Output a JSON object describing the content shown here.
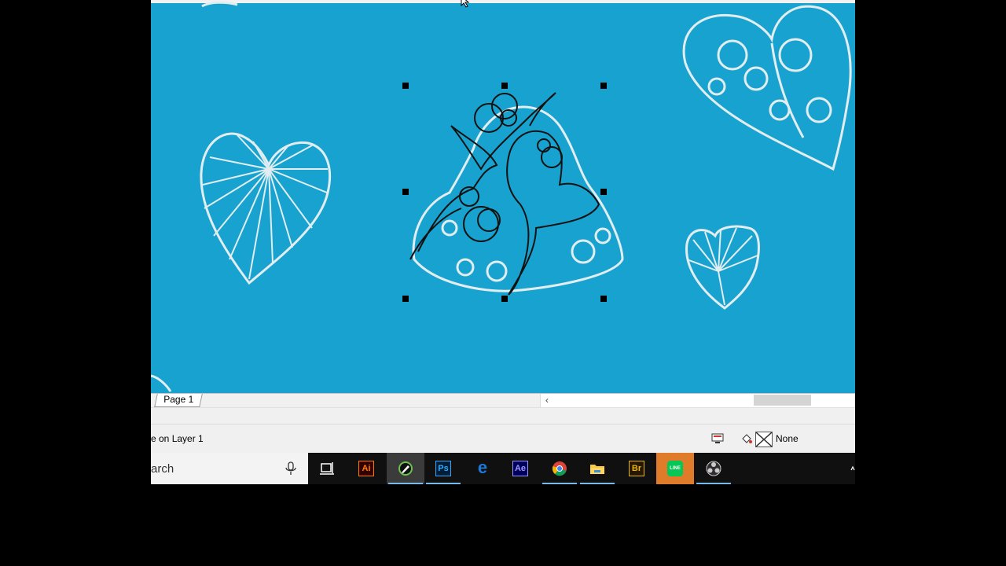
{
  "canvas": {
    "background_color": "#17a2cf",
    "pattern_color": "#dfe9ec",
    "selected_object": "filigree-heart-path"
  },
  "page_tabs": {
    "active_tab": "Page 1"
  },
  "status": {
    "text": "e on Layer 1",
    "fill_label": "None"
  },
  "taskbar": {
    "search_text": "arch",
    "apps": [
      {
        "icon": "task-view-icon"
      },
      {
        "icon": "illustrator-icon",
        "label": "Ai",
        "color": "#ff7c00"
      },
      {
        "icon": "coreldraw-icon"
      },
      {
        "icon": "photoshop-icon",
        "label": "Ps",
        "color": "#31a8ff"
      },
      {
        "icon": "edge-icon",
        "label": "e",
        "color": "#1e78d6"
      },
      {
        "icon": "after-effects-icon",
        "label": "Ae",
        "color": "#9999ff"
      },
      {
        "icon": "chrome-icon"
      },
      {
        "icon": "file-explorer-icon"
      },
      {
        "icon": "bridge-icon",
        "label": "Br",
        "color": "#e8b10b"
      },
      {
        "icon": "line-icon",
        "label": "LINE",
        "color": "#06c755"
      },
      {
        "icon": "obs-icon"
      }
    ]
  }
}
